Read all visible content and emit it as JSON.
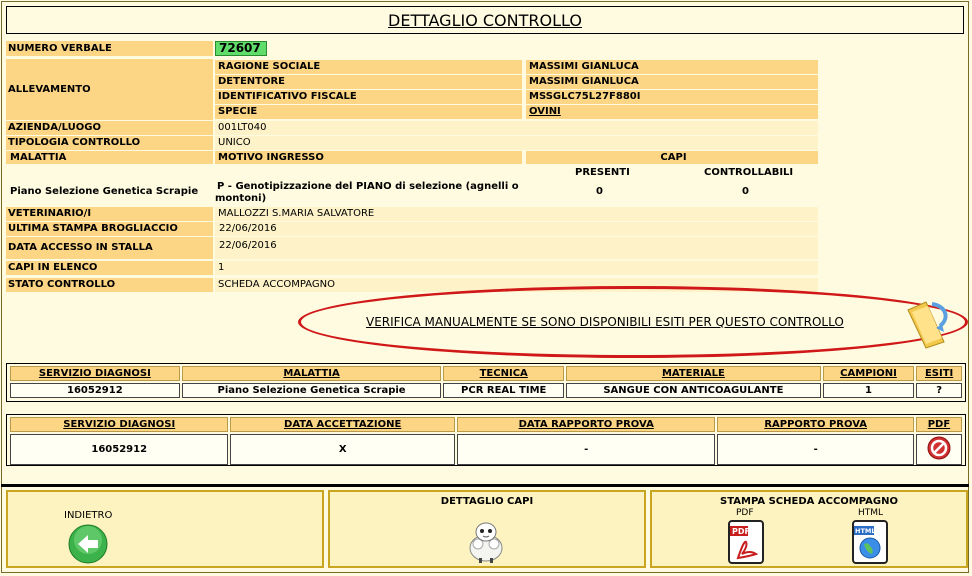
{
  "title": "DETTAGLIO CONTROLLO",
  "fields": {
    "numero_verbale_label": "NUMERO VERBALE",
    "numero_verbale": "72607",
    "allevamento_label": "ALLEVAMENTO",
    "ragione_sociale_label": "RAGIONE SOCIALE",
    "ragione_sociale": "MASSIMI GIANLUCA",
    "detentore_label": "DETENTORE",
    "detentore": "MASSIMI GIANLUCA",
    "identificativo_fiscale_label": "IDENTIFICATIVO FISCALE",
    "identificativo_fiscale": "MSSGLC75L27F880I",
    "specie_label": "SPECIE",
    "specie": "OVINI",
    "azienda_label": "AZIENDA/LUOGO",
    "azienda": "001LT040",
    "tipologia_label": "TIPOLOGIA CONTROLLO",
    "tipologia": "UNICO",
    "malattia_label": "MALATTIA",
    "motivo_label": "MOTIVO INGRESSO",
    "capi_label": "CAPI",
    "presenti_label": "PRESENTI",
    "controllabili_label": "CONTROLLABILI",
    "malattia": "Piano Selezione Genetica Scrapie",
    "motivo_line1": "P - Genotipizzazione del PIANO di selezione (agnelli o",
    "motivo_line2": "montoni)",
    "presenti": "0",
    "controllabili": "0",
    "veterinario_label": "VETERINARIO/I",
    "veterinario": "MALLOZZI S.MARIA SALVATORE",
    "ultima_stampa_label": "ULTIMA STAMPA BROGLIACCIO",
    "ultima_stampa": "22/06/2016",
    "data_accesso_label": "DATA ACCESSO IN STALLA",
    "data_accesso": "22/06/2016",
    "capi_elenco_label": "CAPI IN ELENCO",
    "capi_elenco": "1",
    "stato_label": "STATO CONTROLLO",
    "stato": "SCHEDA ACCOMPAGNO"
  },
  "verifica_link": "VERIFICA MANUALMENTE SE SONO DISPONIBILI ESITI PER QUESTO CONTROLLO",
  "table1": {
    "headers": [
      "SERVIZIO DIAGNOSI",
      "MALATTIA",
      "TECNICA",
      "MATERIALE",
      "CAMPIONI",
      "ESITI"
    ],
    "row": [
      "16052912",
      "Piano Selezione Genetica Scrapie",
      "PCR REAL TIME",
      "SANGUE CON ANTICOAGULANTE",
      "1",
      "?"
    ]
  },
  "table2": {
    "headers": [
      "SERVIZIO DIAGNOSI",
      "DATA ACCETTAZIONE",
      "DATA RAPPORTO PROVA",
      "RAPPORTO PROVA",
      "PDF"
    ],
    "row": [
      "16052912",
      "X",
      "-",
      "-"
    ]
  },
  "footer": {
    "indietro_label": "INDIETRO",
    "dettaglio_capi_label": "DETTAGLIO CAPI",
    "stampa_label": "STAMPA SCHEDA ACCOMPAGNO",
    "pdf_label": "PDF",
    "html_label": "HTML"
  },
  "colors": {
    "header_bg": "#fdd685",
    "value_bg": "#fdf2c8",
    "verbale_bg": "#5fdc6a",
    "ellipse": "#d01818"
  }
}
